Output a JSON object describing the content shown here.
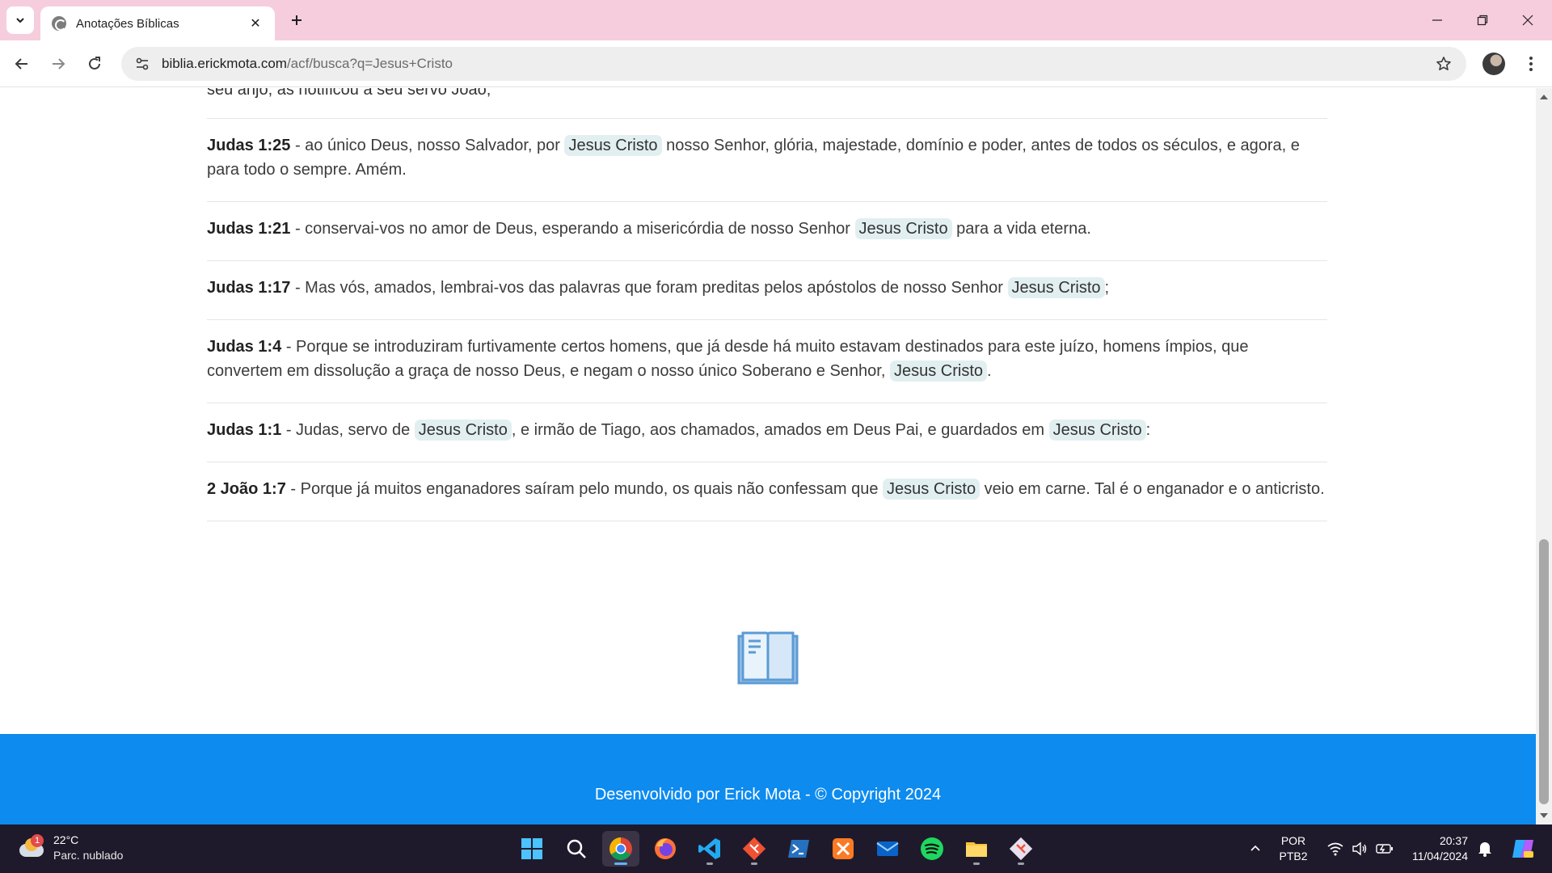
{
  "browser": {
    "tab_title": "Anotações Bíblicas",
    "url_host": "biblia.erickmota.com",
    "url_path": "/acf/busca?q=Jesus+Cristo"
  },
  "page": {
    "cut_text": "seu anjo, as notificou a seu servo João;",
    "verses": [
      {
        "ref": "Judas 1:25",
        "parts": [
          " - ao único Deus, nosso Salvador, por ",
          "Jesus Cristo",
          " nosso Senhor, glória, majestade, domínio e poder, antes de todos os séculos, e agora, e para todo o sempre. Amém."
        ]
      },
      {
        "ref": "Judas 1:21",
        "parts": [
          " - conservai-vos no amor de Deus, esperando a misericórdia de nosso Senhor ",
          "Jesus Cristo",
          " para a vida eterna."
        ]
      },
      {
        "ref": "Judas 1:17",
        "parts": [
          " - Mas vós, amados, lembrai-vos das palavras que foram preditas pelos apóstolos de nosso Senhor ",
          "Jesus Cristo",
          ";"
        ]
      },
      {
        "ref": "Judas 1:4",
        "parts": [
          " - Porque se introduziram furtivamente certos homens, que já desde há muito estavam destinados para este juízo, homens ímpios, que convertem em dissolução a graça de nosso Deus, e negam o nosso único Soberano e Senhor, ",
          "Jesus Cristo",
          "."
        ]
      },
      {
        "ref": "Judas 1:1",
        "parts": [
          " - Judas, servo de ",
          "Jesus Cristo",
          ", e irmão de Tiago, aos chamados, amados em Deus Pai, e guardados em ",
          "Jesus Cristo",
          ":"
        ]
      },
      {
        "ref": "2 João 1:7",
        "parts": [
          " - Porque já muitos enganadores saíram pelo mundo, os quais não confessam que ",
          "Jesus Cristo",
          " veio em carne. Tal é o enganador e o anticristo."
        ]
      }
    ],
    "footer_text": "Desenvolvido por Erick Mota - © Copyright 2024",
    "colors": {
      "footer": "#0d8bef",
      "highlight": "#e2eff1",
      "book": "#5b9bd5"
    }
  },
  "taskbar": {
    "weather_badge": "1",
    "weather_temp": "22°C",
    "weather_cond": "Parc. nublado",
    "lang_line1": "POR",
    "lang_line2": "PTB2",
    "time": "20:37",
    "date": "11/04/2024",
    "apps": [
      "windows-start-icon",
      "search-icon",
      "chrome-icon",
      "firefox-icon",
      "vscode-icon",
      "git-icon",
      "powershell-icon",
      "xampp-icon",
      "mail-icon",
      "spotify-icon",
      "file-explorer-icon",
      "git-tool-icon"
    ]
  }
}
